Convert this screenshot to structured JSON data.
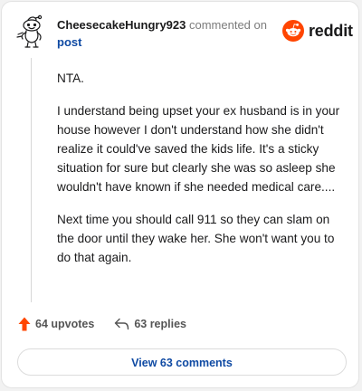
{
  "comment": {
    "username": "CheesecakeHungry923",
    "action_text": "commented on",
    "target_link": "post",
    "paragraphs": [
      "NTA.",
      "I understand being upset your ex husband is in your house however I don't understand how she didn't realize it could've saved the kids life. It's a sticky situation for sure but clearly she was so asleep she wouldn't have known if she needed medical care....",
      "Next time you should call 911 so they can slam on the door until they wake her. She won't want you to do that again."
    ]
  },
  "brand": {
    "wordmark": "reddit",
    "logo_icon": "reddit-snoo-icon",
    "accent_color": "#ff4500"
  },
  "actions": {
    "upvotes_label": "64 upvotes",
    "replies_label": "63 replies",
    "upvote_icon": "upvote-arrow-icon",
    "reply_icon": "reply-arrow-icon",
    "upvote_color": "#ff4500"
  },
  "footer": {
    "view_comments_label": "View 63 comments",
    "link_color": "#0f4aa3"
  },
  "avatar": {
    "icon": "snoo-avatar-icon"
  }
}
